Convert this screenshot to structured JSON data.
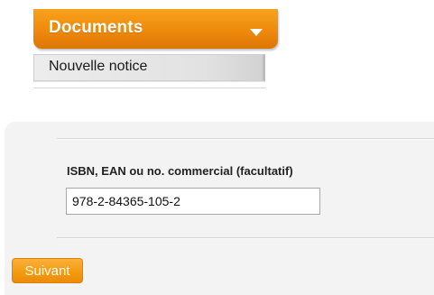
{
  "menu": {
    "title": "Documents",
    "toggle_icon": "chevron-down-icon",
    "items": [
      {
        "label": "Nouvelle notice"
      }
    ]
  },
  "form": {
    "isbn_field": {
      "label": "ISBN, EAN ou no. commercial (facultatif)",
      "value": "978-2-84365-105-2"
    },
    "next_button_label": "Suivant"
  },
  "colors": {
    "accent_orange": "#ee8a0c",
    "panel_background": "#f3f3f3"
  }
}
